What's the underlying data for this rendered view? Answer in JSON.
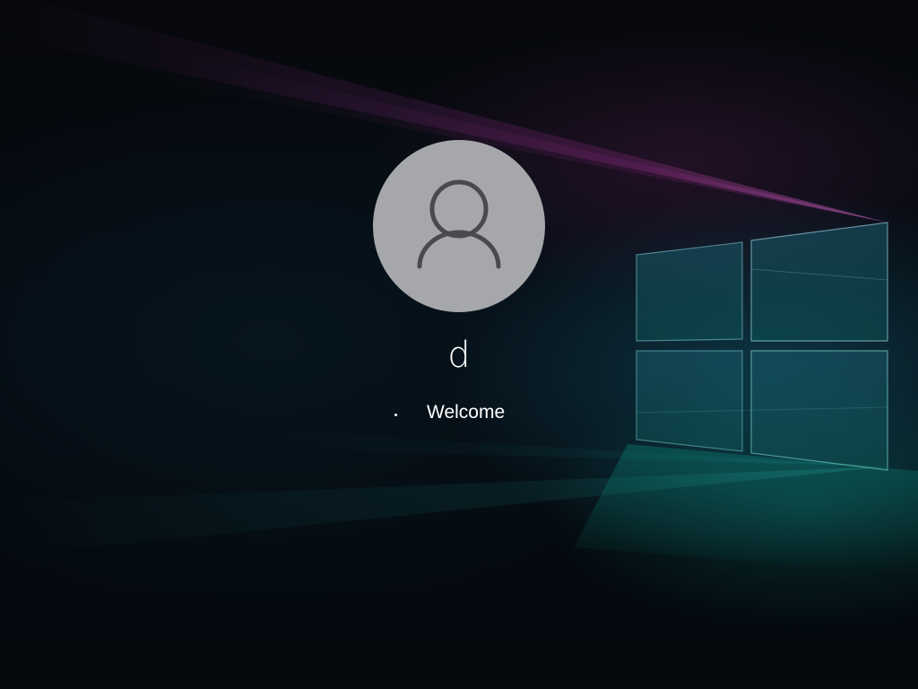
{
  "lock_screen": {
    "user": {
      "name": "d",
      "avatar_icon": "person-icon"
    },
    "status": {
      "text": "Welcome",
      "indicator": "loading-spinner-icon"
    },
    "wallpaper": {
      "description_icon": "windows-logo-icon",
      "accent_colors": [
        "#1f6b80",
        "#0d7a6e",
        "#7a2a72"
      ]
    }
  }
}
